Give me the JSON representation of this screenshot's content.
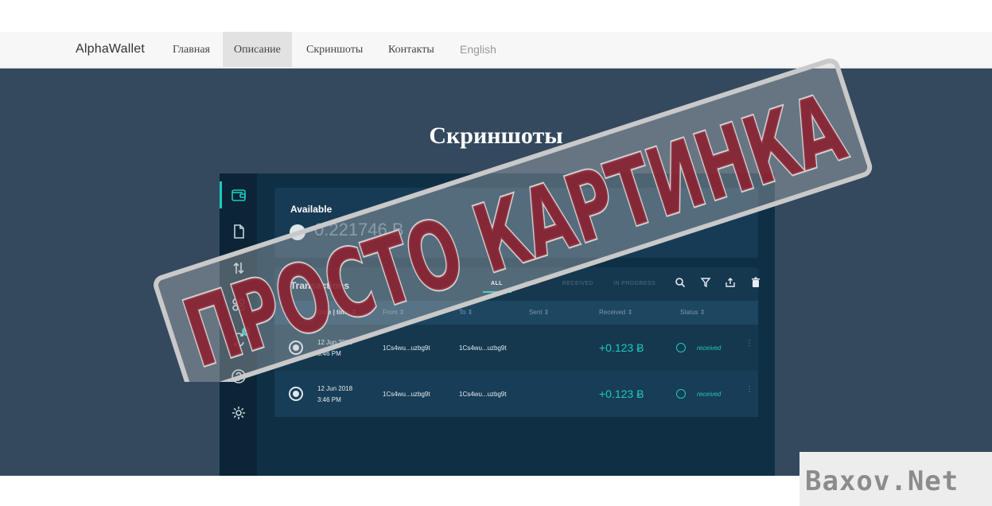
{
  "nav": {
    "brand": "AlphaWallet",
    "items": [
      {
        "label": "Главная"
      },
      {
        "label": "Описание"
      },
      {
        "label": "Скриншоты"
      },
      {
        "label": "Контакты"
      },
      {
        "label": "English"
      }
    ],
    "active_index": 1
  },
  "hero": {
    "title": "Скриншоты"
  },
  "app": {
    "sidebar_icons": [
      "wallet-icon",
      "document-icon",
      "transfer-icon",
      "grid-icon",
      "exchange-icon",
      "help-icon",
      "settings-icon"
    ],
    "exchange_badge": "3",
    "available": {
      "label": "Available",
      "amount": "0.221746 Ƀ"
    },
    "transactions": {
      "title": "Transactions",
      "filters": [
        "ALL",
        "SENT",
        "RECEIVED",
        "IN PROGRESS"
      ],
      "active_filter": "ALL",
      "tools": [
        "search-icon",
        "filter-icon",
        "export-icon",
        "trash-icon"
      ],
      "columns": [
        "Date | time ⇕",
        "From ⇕",
        "To ⇕",
        "Sent ⇕",
        "Received ⇕",
        "Status ⇕"
      ],
      "rows": [
        {
          "date": "12 Jun 2018",
          "time": "3:46 PM",
          "from": "1Cs4wu...uzbg9t",
          "to": "1Cs4wu...uzbg9t",
          "received": "+0.123 Ƀ",
          "status": "received"
        },
        {
          "date": "12 Jun 2018",
          "time": "3:46 PM",
          "from": "1Cs4wu...uzbg9t",
          "to": "1Cs4wu...uzbg9t",
          "received": "+0.123 Ƀ",
          "status": "received"
        }
      ]
    }
  },
  "overlay": {
    "stamp_text": "ПРОСТО КАРТИНКА",
    "stamp_color": "#8b1f2e"
  },
  "watermark": {
    "text": "Baxov.Net"
  },
  "colors": {
    "hero_bg": "#34495e",
    "accent": "#1ec9c0",
    "app_bg": "#0f2f44"
  }
}
